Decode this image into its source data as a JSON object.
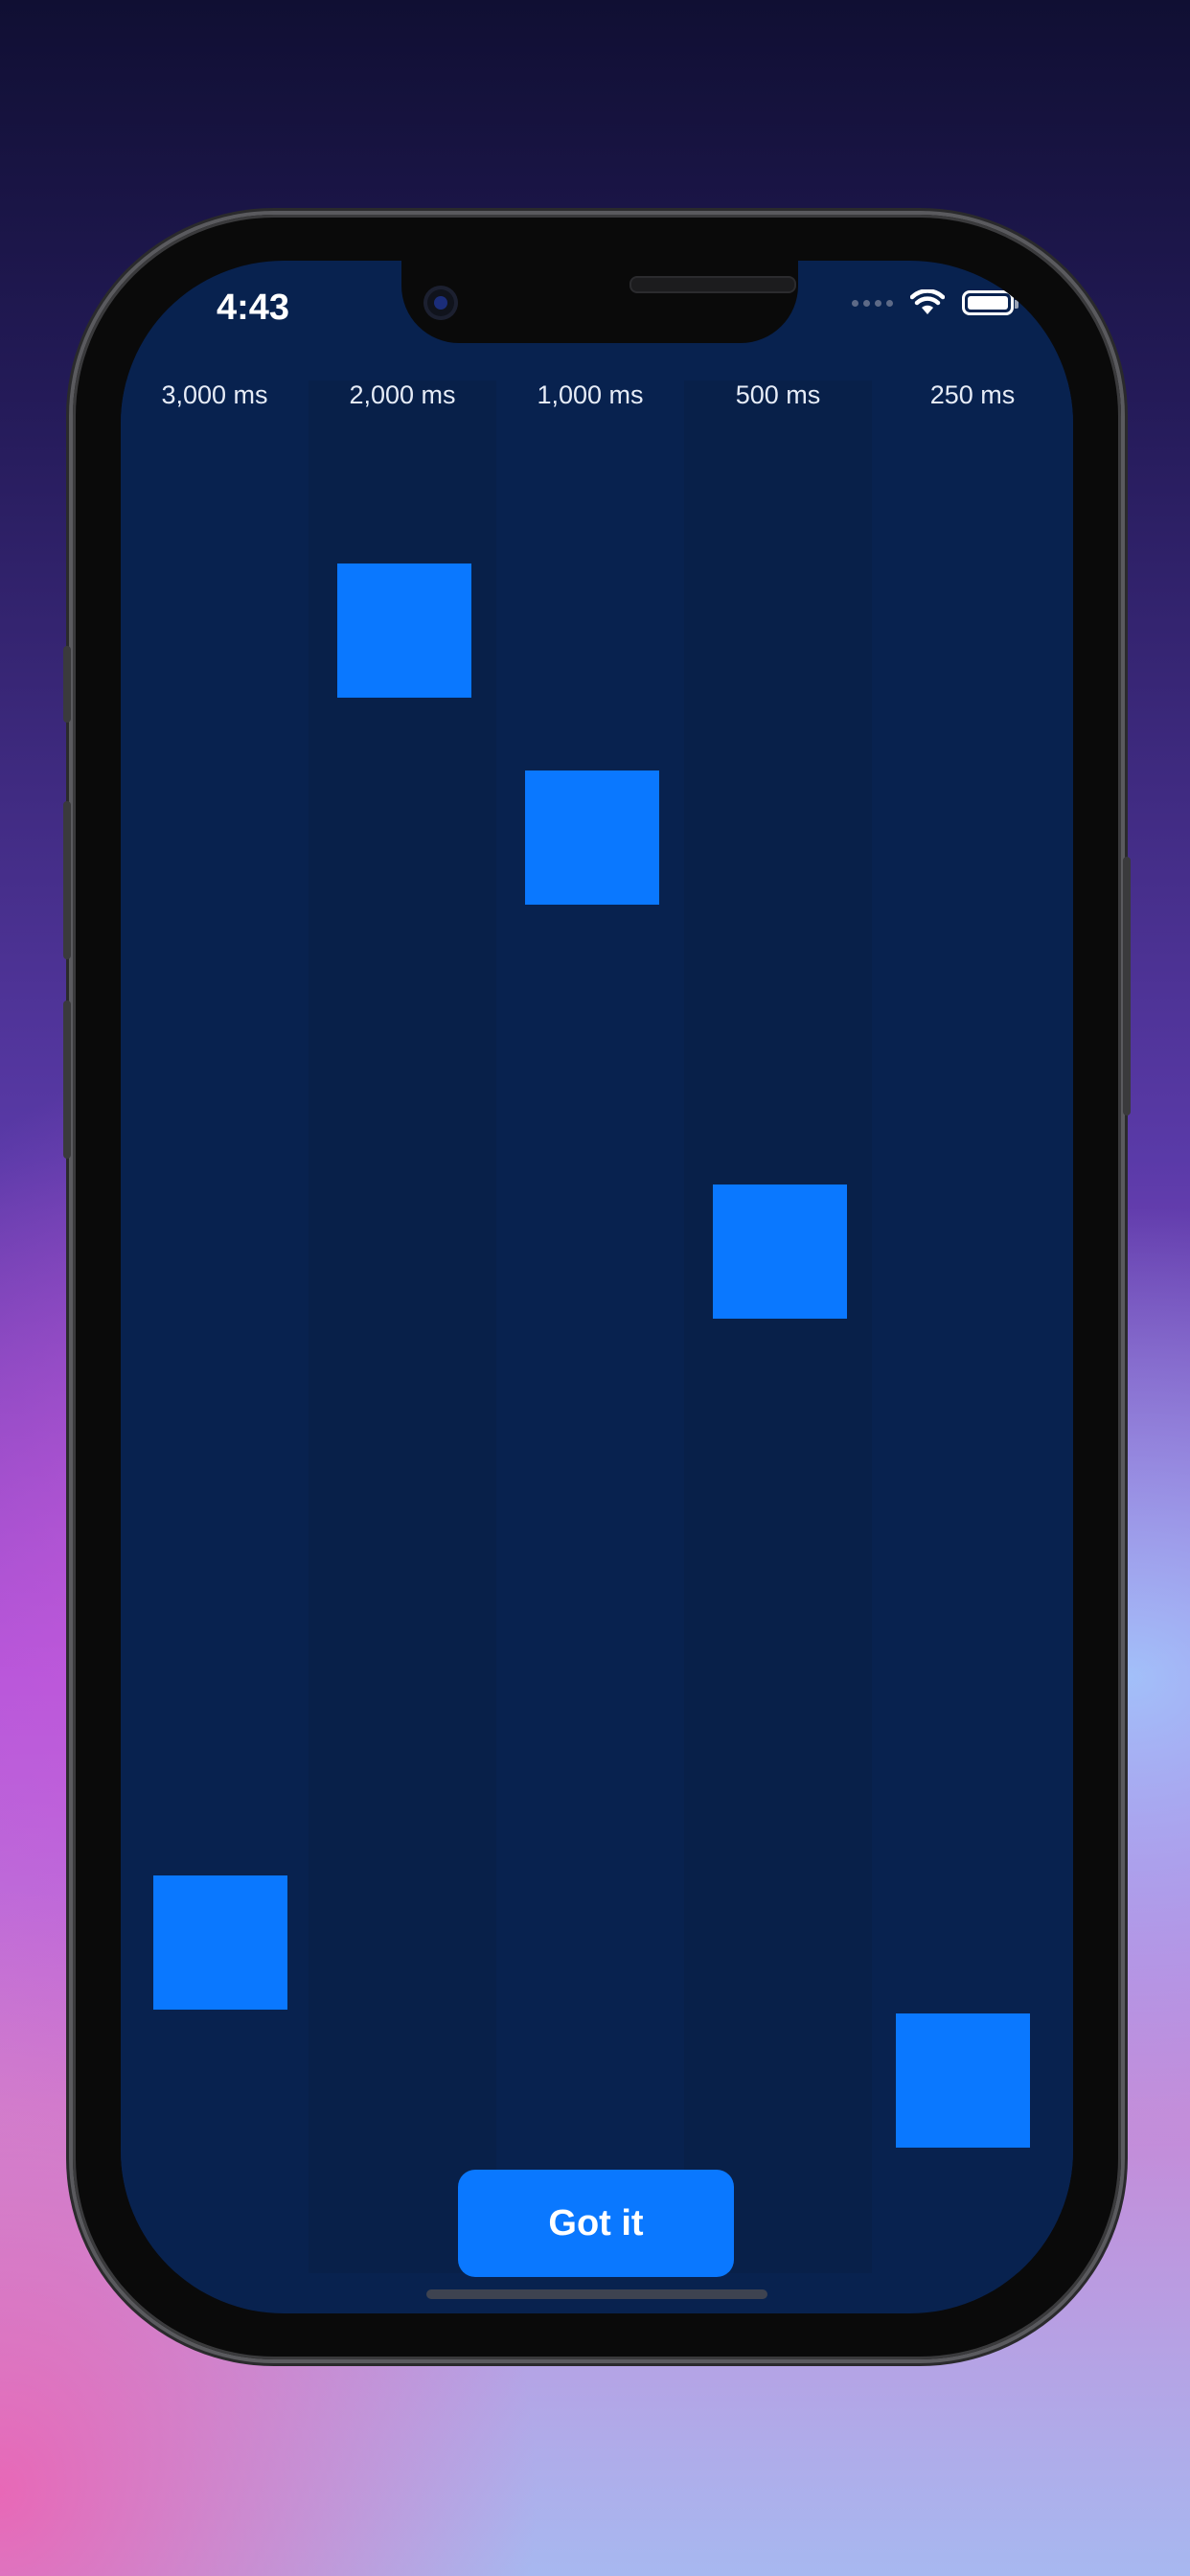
{
  "status_bar": {
    "time": "4:43",
    "icons": [
      "signal-icon",
      "wifi-icon",
      "battery-icon"
    ]
  },
  "lanes": [
    {
      "label": "3,000 ms",
      "square_progress": 0.85
    },
    {
      "label": "2,000 ms",
      "square_progress": 0.13
    },
    {
      "label": "1,000 ms",
      "square_progress": 0.24
    },
    {
      "label": "500 ms",
      "square_progress": 0.46
    },
    {
      "label": "250 ms",
      "square_progress": 0.92
    }
  ],
  "actions": {
    "got_it_label": "Got it"
  },
  "colors": {
    "screen_background": "#08224f",
    "lane_alt_background": "#082049",
    "square": "#0a78ff",
    "button": "#0a78ff"
  }
}
